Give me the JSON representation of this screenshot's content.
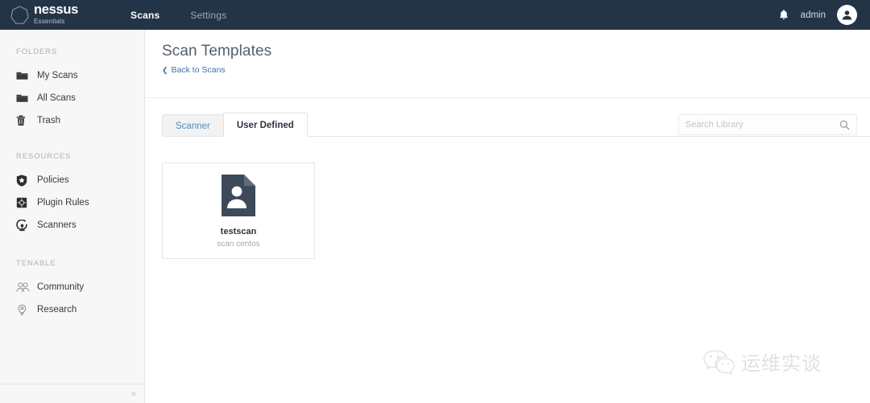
{
  "brand": {
    "name": "nessus",
    "subtitle": "Essentials",
    "logo_icon": "heptagon-outline-icon"
  },
  "topnav": {
    "items": [
      {
        "label": "Scans",
        "active": true
      },
      {
        "label": "Settings",
        "active": false
      }
    ]
  },
  "topright": {
    "notifications_icon": "bell-icon",
    "user": "admin",
    "avatar_icon": "user-avatar-icon"
  },
  "sidebar": {
    "groups": [
      {
        "label": "FOLDERS",
        "items": [
          {
            "label": "My Scans",
            "icon": "folder-icon"
          },
          {
            "label": "All Scans",
            "icon": "folder-icon"
          },
          {
            "label": "Trash",
            "icon": "trash-icon"
          }
        ]
      },
      {
        "label": "RESOURCES",
        "items": [
          {
            "label": "Policies",
            "icon": "shield-star-icon"
          },
          {
            "label": "Plugin Rules",
            "icon": "plugin-chip-icon"
          },
          {
            "label": "Scanners",
            "icon": "radar-icon"
          }
        ]
      },
      {
        "label": "TENABLE",
        "items": [
          {
            "label": "Community",
            "icon": "people-icon"
          },
          {
            "label": "Research",
            "icon": "lightbulb-search-icon"
          }
        ]
      }
    ],
    "collapse_glyph": "«"
  },
  "main": {
    "page_title": "Scan Templates",
    "back_link": "Back to Scans",
    "back_chevron": "❮",
    "tabs": [
      {
        "label": "Scanner",
        "active": false
      },
      {
        "label": "User Defined",
        "active": true
      }
    ],
    "search": {
      "placeholder": "Search Library",
      "value": "",
      "icon": "search-icon"
    },
    "templates": [
      {
        "name": "testscan",
        "description": "scan centos",
        "icon": "user-document-icon"
      }
    ]
  },
  "watermark": {
    "icon": "wechat-icon",
    "text": "运维实谈"
  },
  "colors": {
    "topbar_bg": "#243447",
    "sidebar_bg": "#f7f7f7",
    "accent_link": "#3c72a8",
    "tab_inactive_text": "#4a90c4",
    "template_icon": "#3c4a5a"
  }
}
